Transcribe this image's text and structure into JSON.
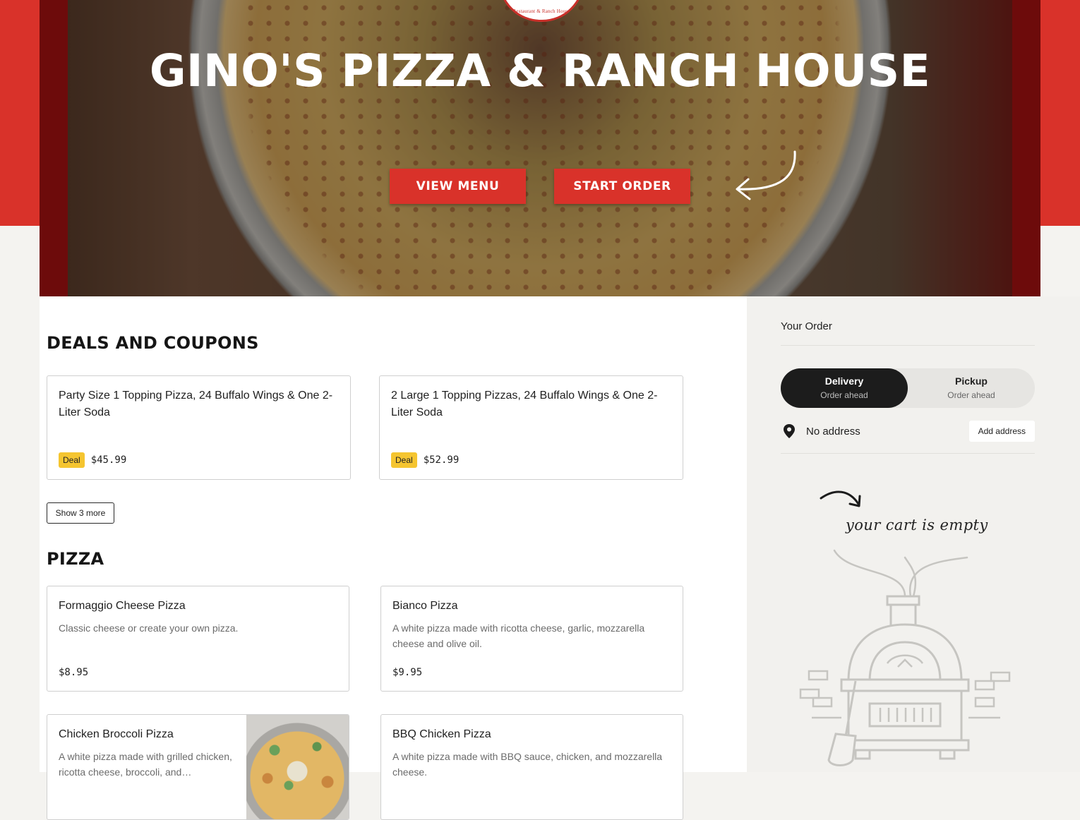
{
  "hero": {
    "logo_text": "Restaurant & Ranch House",
    "title": "GINO'S PIZZA & RANCH HOUSE",
    "view_menu_label": "VIEW MENU",
    "start_order_label": "START ORDER"
  },
  "deals": {
    "title": "DEALS AND COUPONS",
    "show_more_label": "Show 3 more",
    "items": [
      {
        "name": "Party Size 1 Topping Pizza, 24 Buffalo Wings & One 2-Liter Soda",
        "badge": "Deal",
        "price": "$45.99"
      },
      {
        "name": "2 Large 1 Topping Pizzas, 24 Buffalo Wings & One 2-Liter Soda",
        "badge": "Deal",
        "price": "$52.99"
      }
    ]
  },
  "pizza": {
    "title": "PIZZA",
    "items": [
      {
        "name": "Formaggio Cheese Pizza",
        "description": "Classic cheese or create your own pizza.",
        "price": "$8.95"
      },
      {
        "name": "Bianco Pizza",
        "description": "A white pizza made with ricotta cheese, garlic, mozzarella cheese and olive oil.",
        "price": "$9.95"
      },
      {
        "name": "Chicken Broccoli Pizza",
        "description": "A white pizza made with grilled chicken, ricotta cheese, broccoli, and…"
      },
      {
        "name": "BBQ Chicken Pizza",
        "description": "A white pizza made with BBQ sauce, chicken, and mozzarella cheese."
      }
    ]
  },
  "order": {
    "title": "Your Order",
    "modes": [
      {
        "label": "Delivery",
        "sub": "Order ahead"
      },
      {
        "label": "Pickup",
        "sub": "Order ahead"
      }
    ],
    "address_text": "No address",
    "add_address_label": "Add address",
    "empty_text": "your cart is empty"
  },
  "colors": {
    "brand_red": "#d9322a",
    "deal_yellow": "#f5c530",
    "toggle_active": "#1c1c1c"
  }
}
